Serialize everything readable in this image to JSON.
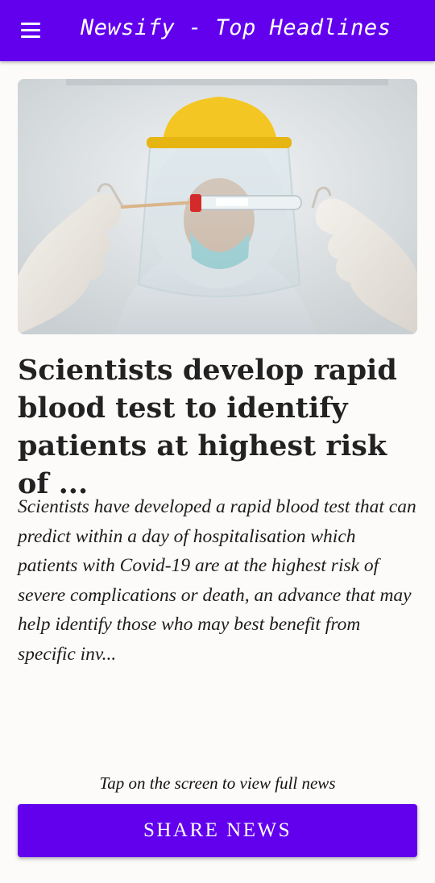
{
  "app_bar": {
    "title": "Newsify - Top Headlines",
    "menu_icon": "hamburger-menu-icon",
    "color": "#6200ee"
  },
  "article": {
    "image_description_icon": "article-photo",
    "headline": "Scientists develop rapid blood test to identify patients at highest risk of ...",
    "description": "Scientists have developed a rapid blood test that can predict within a day of hospitalisation which patients with Covid-19 are at the highest risk of severe complications or death, an advance that may help identify those who may best benefit from specific inv..."
  },
  "footer": {
    "hint": "Tap on the screen to view full news",
    "share_label": "SHARE NEWS"
  }
}
